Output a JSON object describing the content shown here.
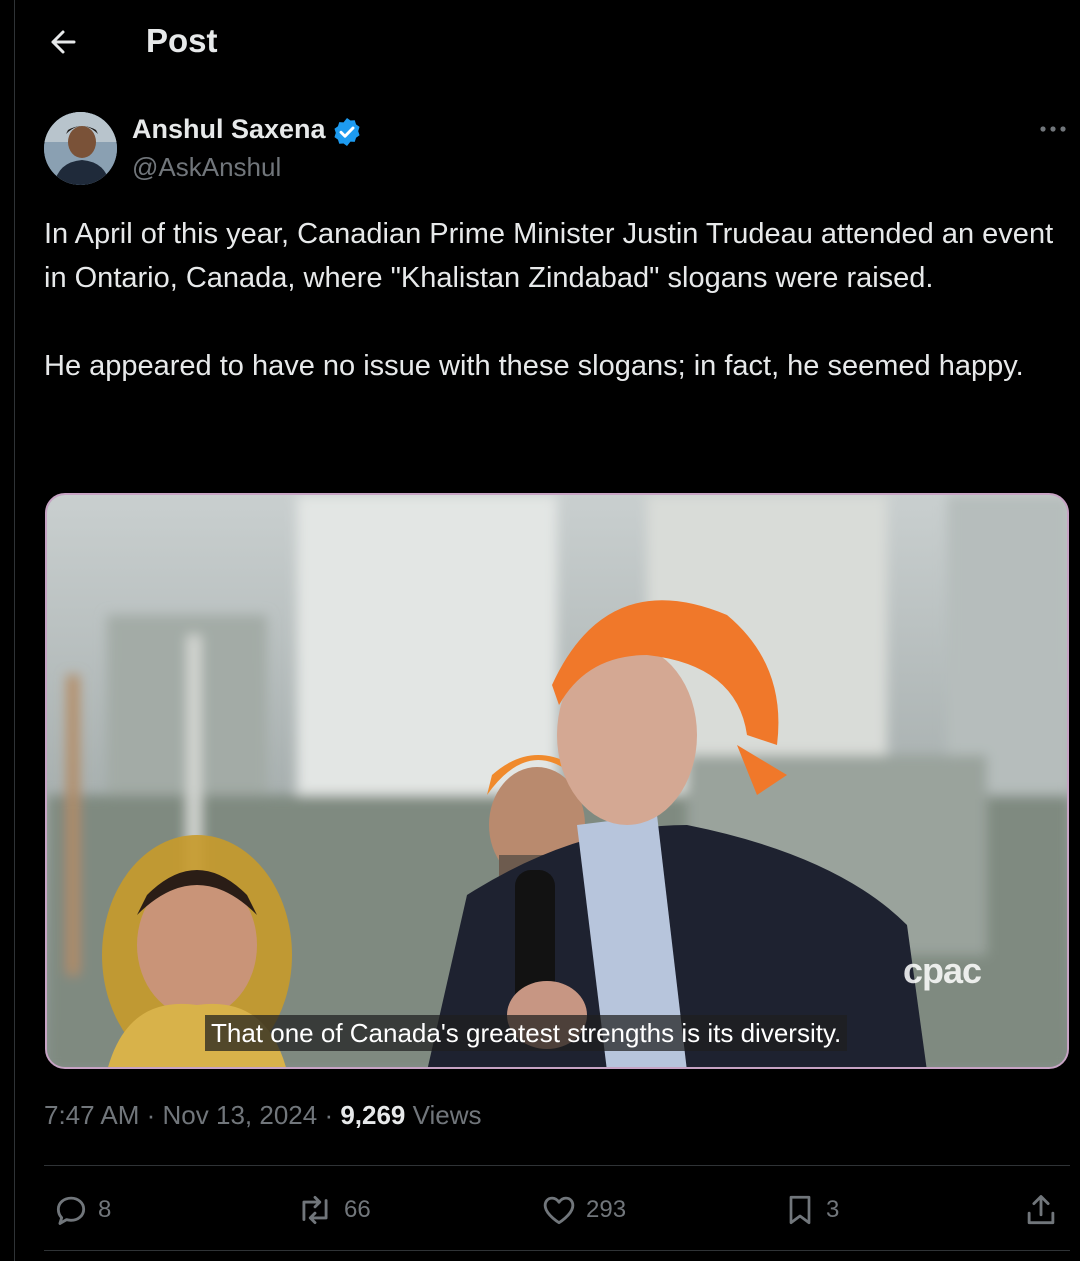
{
  "header": {
    "title": "Post",
    "back_icon": "arrow-left-icon"
  },
  "author": {
    "name": "Anshul Saxena",
    "handle": "@AskAnshul",
    "verified": true,
    "verified_color": "#1d9bf0"
  },
  "post": {
    "text": "In April of this year, Canadian Prime Minister Justin Trudeau attended an event in Ontario, Canada, where \"Khalistan Zindabad\" slogans were raised.\n\nHe appeared to have no issue with these slogans; in fact, he seemed happy.",
    "media": {
      "caption": "That one of Canada's greatest strengths is its diversity.",
      "watermark": "cpac"
    },
    "time": "7:47 AM",
    "date": "Nov 13, 2024",
    "views_count": "9,269",
    "views_label": "Views"
  },
  "actions": {
    "replies": "8",
    "reposts": "66",
    "likes": "293",
    "bookmarks": "3"
  },
  "colors": {
    "background": "#000000",
    "text": "#e7e9ea",
    "muted": "#71767b",
    "accent": "#1d9bf0",
    "media_border": "#c7a3c4"
  }
}
